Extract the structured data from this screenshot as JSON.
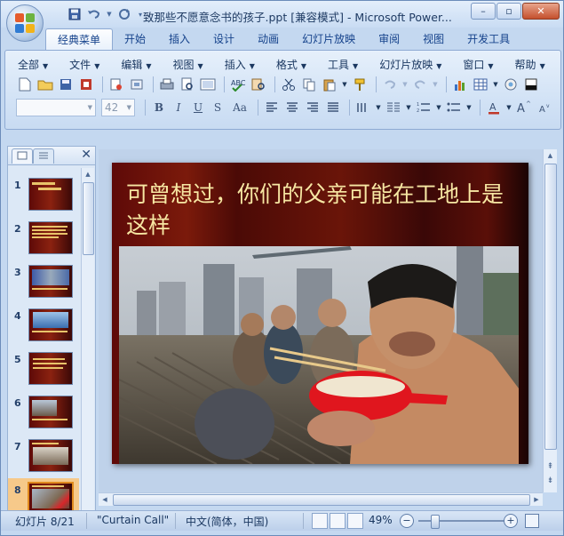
{
  "window": {
    "title": "致那些不愿意念书的孩子.ppt [兼容模式] - Microsoft Power...",
    "controls": [
      "–",
      "▫",
      "✕"
    ]
  },
  "quick_access": [
    "save-icon",
    "undo-icon",
    "redo-icon"
  ],
  "tabs": [
    {
      "label": "经典菜单",
      "active": true
    },
    {
      "label": "开始"
    },
    {
      "label": "插入"
    },
    {
      "label": "设计"
    },
    {
      "label": "动画"
    },
    {
      "label": "幻灯片放映"
    },
    {
      "label": "审阅"
    },
    {
      "label": "视图"
    },
    {
      "label": "开发工具"
    }
  ],
  "menus": [
    "全部",
    "文件",
    "编辑",
    "视图",
    "插入",
    "格式",
    "工具",
    "幻灯片放映",
    "窗口",
    "帮助"
  ],
  "font": {
    "name_value": "",
    "size_value": "42"
  },
  "format_buttons": [
    "B",
    "I",
    "U",
    "S",
    "Aa"
  ],
  "slide_panel": {
    "slides": [
      {
        "num": "1"
      },
      {
        "num": "2"
      },
      {
        "num": "3"
      },
      {
        "num": "4"
      },
      {
        "num": "5"
      },
      {
        "num": "6"
      },
      {
        "num": "7"
      },
      {
        "num": "8",
        "selected": true
      }
    ]
  },
  "slide": {
    "title": "可曾想过，你们的父亲可能在工地上是这样"
  },
  "status": {
    "slide_info": "幻灯片 8/21",
    "theme": "\"Curtain Call\"",
    "language": "中文(简体，中国)",
    "zoom": "49%",
    "zoom_fraction": 0.49
  },
  "colors": {
    "accent": "#1e395b",
    "slide_title": "#f7e7a3",
    "selection": "#f6c98a"
  }
}
